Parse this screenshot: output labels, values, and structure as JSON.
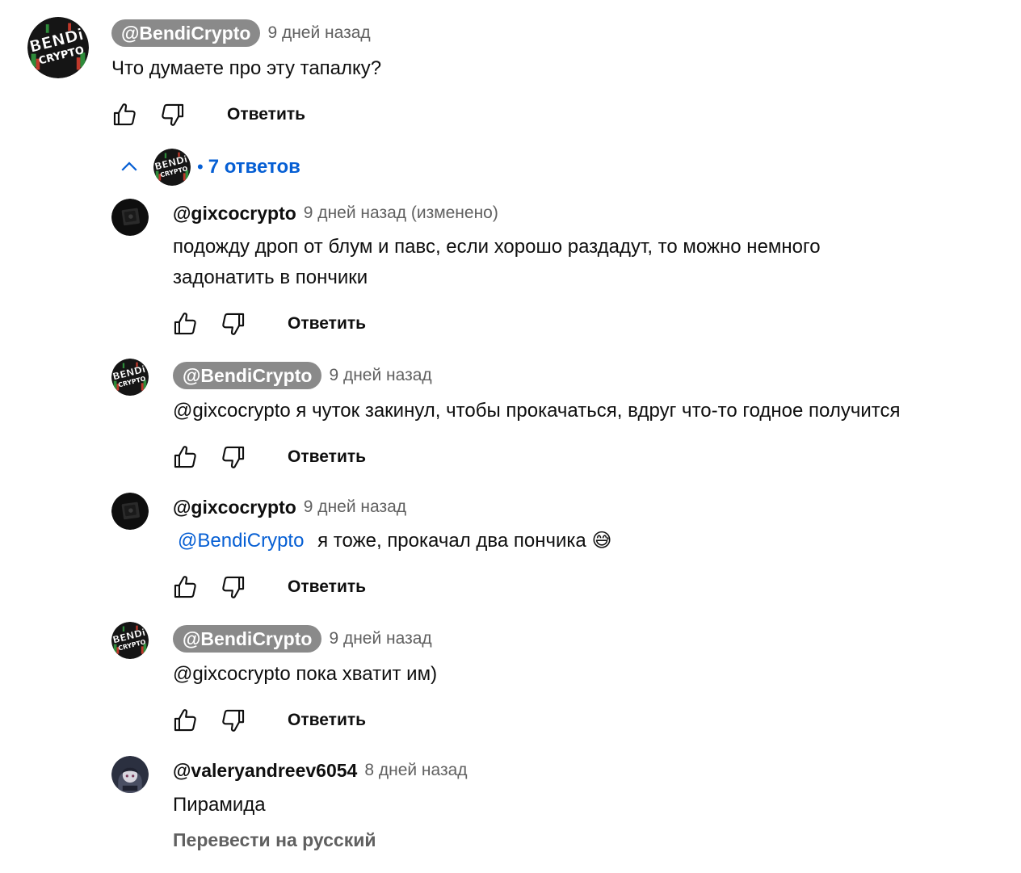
{
  "thread": {
    "top": {
      "author": "@BendiCrypto",
      "time": "9 дней назад",
      "text": "Что думаете про эту тапалку?",
      "reply_label": "Ответить",
      "avatar_text_1": "BENDi",
      "avatar_text_2": "CRYPTO"
    },
    "replies_toggle": {
      "count_label": "7 ответов",
      "dot": "•"
    },
    "replies": [
      {
        "author": "@gixcocrypto",
        "time": "9 дней назад (изменено)",
        "text": "подожду дроп от блум и павс, если хорошо раздадут, то можно немного задонатить в пончики",
        "reply_label": "Ответить"
      },
      {
        "author": "@BendiCrypto",
        "time": "9 дней назад",
        "text": "@gixcocrypto  я чуток закинул, чтобы прокачаться, вдруг что-то годное получится",
        "reply_label": "Ответить"
      },
      {
        "author": "@gixcocrypto",
        "time": "9 дней назад",
        "mention": "@BendiCrypto",
        "text": "я тоже, прокачал два пончика",
        "emoji": "😅",
        "reply_label": "Ответить"
      },
      {
        "author": "@BendiCrypto",
        "time": "9 дней назад",
        "text": "@gixcocrypto  пока хватит им)",
        "reply_label": "Ответить"
      },
      {
        "author": "@valeryandreev6054",
        "time": "8 дней назад",
        "text": "Пирамида",
        "translate_label": "Перевести на русский"
      }
    ]
  },
  "colors": {
    "link": "#065fd4",
    "chip_bg": "#8a8a8a",
    "muted": "#606060"
  }
}
